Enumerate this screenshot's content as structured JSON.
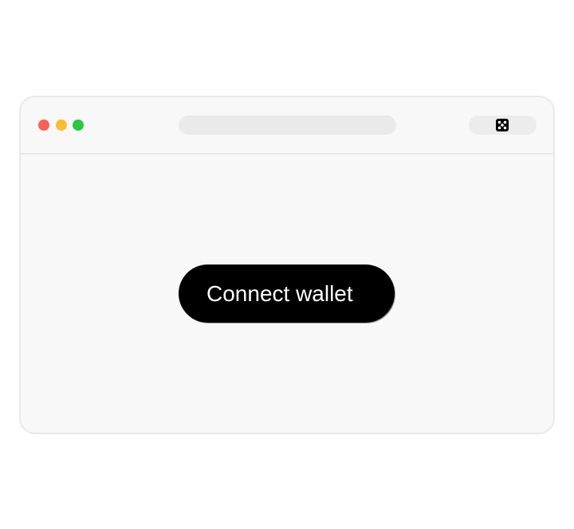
{
  "window": {
    "controls": [
      "close",
      "minimize",
      "zoom"
    ],
    "control_colors": {
      "close": "#fe5f57",
      "minimize": "#febc2e",
      "zoom": "#28c840"
    },
    "address_bar": {
      "value": "",
      "color": "#eaeaea"
    },
    "extension": {
      "icon": "dice-icon"
    }
  },
  "main": {
    "connect_button": {
      "label": "Connect wallet",
      "background": "#000000",
      "text_color": "#ffffff"
    }
  }
}
